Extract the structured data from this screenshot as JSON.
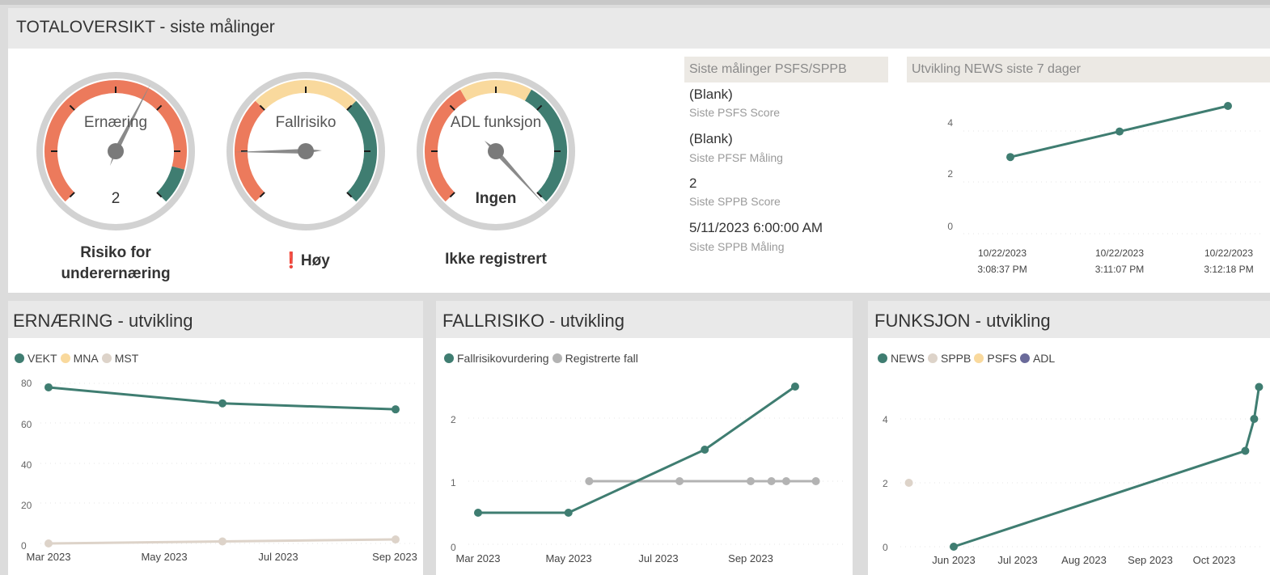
{
  "header": {
    "title": "TOTALOVERSIKT - siste målinger"
  },
  "gauges": [
    {
      "label": "Ernæring",
      "value": "2",
      "status": "Risiko for\nunderernæring",
      "icon": ""
    },
    {
      "label": "Fallrisiko",
      "value": "",
      "status": "Høy",
      "icon": "exclamation-icon"
    },
    {
      "label": "ADL funksjon",
      "value": "Ingen",
      "status": "Ikke registrert",
      "icon": ""
    }
  ],
  "measurements": {
    "title": "Siste målinger PSFS/SPPB",
    "items": [
      {
        "value": "(Blank)",
        "label": "Siste PSFS Score"
      },
      {
        "value": "(Blank)",
        "label": "Siste PFSF Måling"
      },
      {
        "value": "2",
        "label": "Siste SPPB Score"
      },
      {
        "value": "5/11/2023 6:00:00 AM",
        "label": "Siste SPPB Måling"
      }
    ]
  },
  "colors": {
    "teal": "#3f7d71",
    "salmon": "#ec7a5c",
    "sand": "#f9d99d",
    "beige": "#ddd3c9",
    "gray": "#b3b3b3",
    "purple": "#6a6a9a"
  },
  "charts": {
    "news7": {
      "title": "Utvikling NEWS siste 7 dager",
      "yticks": [
        "0",
        "2",
        "4"
      ],
      "xticks": [
        {
          "l1": "10/22/2023",
          "l2": "3:08:37 PM"
        },
        {
          "l1": "10/22/2023",
          "l2": "3:11:07 PM"
        },
        {
          "l1": "10/22/2023",
          "l2": "3:12:18 PM"
        }
      ]
    },
    "ernaering": {
      "title": "ERNÆRING - utvikling",
      "legend": [
        {
          "name": "VEKT",
          "color": "#3f7d71"
        },
        {
          "name": "MNA",
          "color": "#f9d99d"
        },
        {
          "name": "MST",
          "color": "#ddd3c9"
        }
      ],
      "yticks": [
        "0",
        "20",
        "40",
        "60",
        "80"
      ],
      "xticks": [
        "Mar 2023",
        "May 2023",
        "Jul 2023",
        "Sep 2023"
      ]
    },
    "fallrisiko": {
      "title": "FALLRISIKO - utvikling",
      "legend": [
        {
          "name": "Fallrisikovurdering",
          "color": "#3f7d71"
        },
        {
          "name": "Registrerte fall",
          "color": "#b3b3b3"
        }
      ],
      "yticks": [
        "0",
        "1",
        "2"
      ],
      "xticks": [
        "Mar 2023",
        "May 2023",
        "Jul 2023",
        "Sep 2023"
      ]
    },
    "funksjon": {
      "title": "FUNKSJON - utvikling",
      "legend": [
        {
          "name": "NEWS",
          "color": "#3f7d71"
        },
        {
          "name": "SPPB",
          "color": "#ddd3c9"
        },
        {
          "name": "PSFS",
          "color": "#f9d99d"
        },
        {
          "name": "ADL",
          "color": "#6a6a9a"
        }
      ],
      "yticks": [
        "0",
        "2",
        "4"
      ],
      "xticks": [
        "Jun 2023",
        "Jul 2023",
        "Aug 2023",
        "Sep 2023",
        "Oct 2023"
      ]
    }
  },
  "chart_data": [
    {
      "type": "line",
      "title": "Utvikling NEWS siste 7 dager",
      "x": [
        "10/22/2023 3:08:37 PM",
        "10/22/2023 3:11:07 PM",
        "10/22/2023 3:12:18 PM"
      ],
      "series": [
        {
          "values": [
            3,
            4,
            5
          ]
        }
      ],
      "ylim": [
        0,
        5
      ]
    },
    {
      "type": "line",
      "title": "ERNÆRING - utvikling",
      "x": [
        "Mar 2023",
        "Jun 2023",
        "Sep 2023"
      ],
      "series": [
        {
          "name": "VEKT",
          "values": [
            78,
            70,
            67
          ]
        },
        {
          "name": "MST",
          "values": [
            0,
            1,
            2
          ]
        }
      ],
      "ylim": [
        0,
        85
      ]
    },
    {
      "type": "line",
      "title": "FALLRISIKO - utvikling",
      "series": [
        {
          "name": "Fallrisikovurdering",
          "x": [
            "2023-03-01",
            "2023-05-01",
            "2023-08-01",
            "2023-10-01"
          ],
          "values": [
            0.5,
            0.5,
            1.5,
            2.5
          ]
        },
        {
          "name": "Registrerte fall",
          "x": [
            "2023-05-15",
            "2023-07-15",
            "2023-09-01",
            "2023-09-15",
            "2023-09-25",
            "2023-10-15"
          ],
          "values": [
            1,
            1,
            1,
            1,
            1,
            1
          ]
        }
      ],
      "ylim": [
        0,
        2.6
      ]
    },
    {
      "type": "line",
      "title": "FUNKSJON - utvikling",
      "series": [
        {
          "name": "NEWS",
          "x": [
            "2023-06-01",
            "2023-10-22",
            "2023-10-22",
            "2023-10-22"
          ],
          "values": [
            0,
            3,
            4,
            5
          ]
        },
        {
          "name": "SPPB",
          "x": [
            "2023-05-11"
          ],
          "values": [
            2
          ]
        }
      ],
      "ylim": [
        0,
        5.2
      ]
    }
  ]
}
